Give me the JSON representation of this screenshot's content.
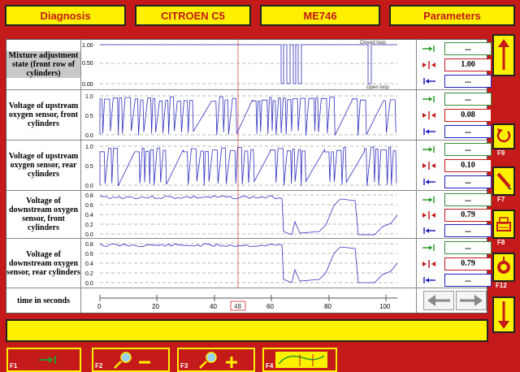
{
  "header": {
    "diagnosis": "Diagnosis",
    "vehicle": "CITROEN C5",
    "ecu": "ME746",
    "parameters": "Parameters"
  },
  "rows": [
    {
      "label": "Mixture adjustment state (front row of cylinders)",
      "ticks": [
        "1.00",
        "0.50",
        "0.00"
      ],
      "top_note": "Closed loop",
      "bottom_note": "Open loop",
      "values": [
        "...",
        "1.00",
        "..."
      ]
    },
    {
      "label": "Voltage of upstream oxygen sensor, front cylinders",
      "ticks": [
        "1.0",
        "0.5",
        "0.0"
      ],
      "values": [
        "...",
        "0.08",
        "..."
      ]
    },
    {
      "label": "Voltage of upstream oxygen sensor, rear cylinders",
      "ticks": [
        "1.0",
        "0.5",
        "0.0"
      ],
      "values": [
        "...",
        "0.10",
        "..."
      ]
    },
    {
      "label": "Voltage of downstream oxygen sensor, front cylinders",
      "ticks": [
        "0.8",
        "0.6",
        "0.4",
        "0.2",
        "0.0"
      ],
      "values": [
        "...",
        "0.79",
        "..."
      ]
    },
    {
      "label": "Voltage of downstream oxygen sensor, rear cylinders",
      "ticks": [
        "0.8",
        "0.6",
        "0.4",
        "0.2",
        "0.0"
      ],
      "values": [
        "...",
        "0.79",
        "..."
      ]
    }
  ],
  "time_axis": {
    "label": "time in seconds",
    "ticks": [
      "0",
      "20",
      "40",
      "60",
      "80",
      "100"
    ],
    "cursor": "48"
  },
  "icons": {
    "scroll_up": "arrow-up-icon",
    "scroll_down": "arrow-down-icon",
    "f9": "refresh-icon",
    "f7": "pencil-icon",
    "f8": "print-icon",
    "f12": "record-icon",
    "zoom_out": "magnifier-minus-icon",
    "zoom_in": "magnifier-plus-icon"
  },
  "fkeys": {
    "f1": "F1",
    "f2": "F2",
    "f3": "F3",
    "f4": "F4",
    "f7": "F7",
    "f8": "F8",
    "f9": "F9",
    "f12": "F12"
  },
  "colors": {
    "background": "#c41a1a",
    "button": "#fdf100",
    "trace": "#3030c0",
    "cursor": "#e05050"
  }
}
